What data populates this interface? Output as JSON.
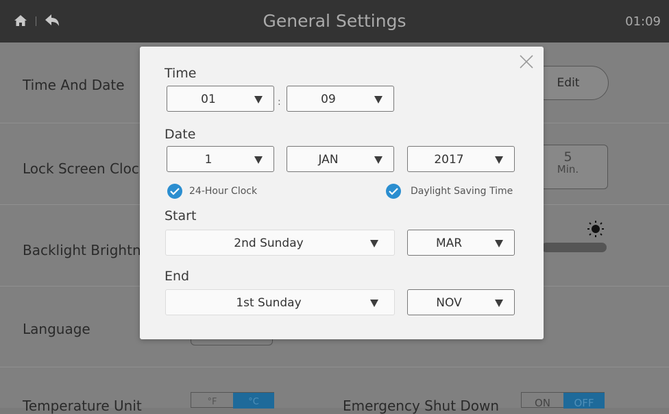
{
  "header": {
    "title": "General Settings",
    "clock": "01:09",
    "home_icon": "home-icon",
    "back_icon": "back-icon"
  },
  "background": {
    "rows": [
      {
        "label": "Time And Date"
      },
      {
        "label": "Lock Screen Clock"
      },
      {
        "label": "Backlight Brightness"
      },
      {
        "label": "Language"
      },
      {
        "label": "Temperature Unit"
      }
    ],
    "edit_label": "Edit",
    "lock_value": "5",
    "lock_unit": "Min.",
    "temp_f": "°F",
    "temp_c": "°C",
    "emergency_label": "Emergency Shut Down",
    "emergency_on": "ON",
    "emergency_off": "OFF"
  },
  "dialog": {
    "time_label": "Time",
    "hour": "01",
    "minute": "09",
    "colon": ":",
    "date_label": "Date",
    "day": "1",
    "month": "JAN",
    "year": "2017",
    "clock24_label": "24-Hour Clock",
    "clock24_checked": true,
    "dst_label": "Daylight Saving Time",
    "dst_checked": true,
    "start_label": "Start",
    "start_week": "2nd Sunday",
    "start_month": "MAR",
    "end_label": "End",
    "end_week": "1st Sunday",
    "end_month": "NOV"
  },
  "colors": {
    "accent": "#2b8ed0",
    "topbar": "#333333",
    "overlay": "#808080",
    "dialog": "#f2f2f2"
  }
}
